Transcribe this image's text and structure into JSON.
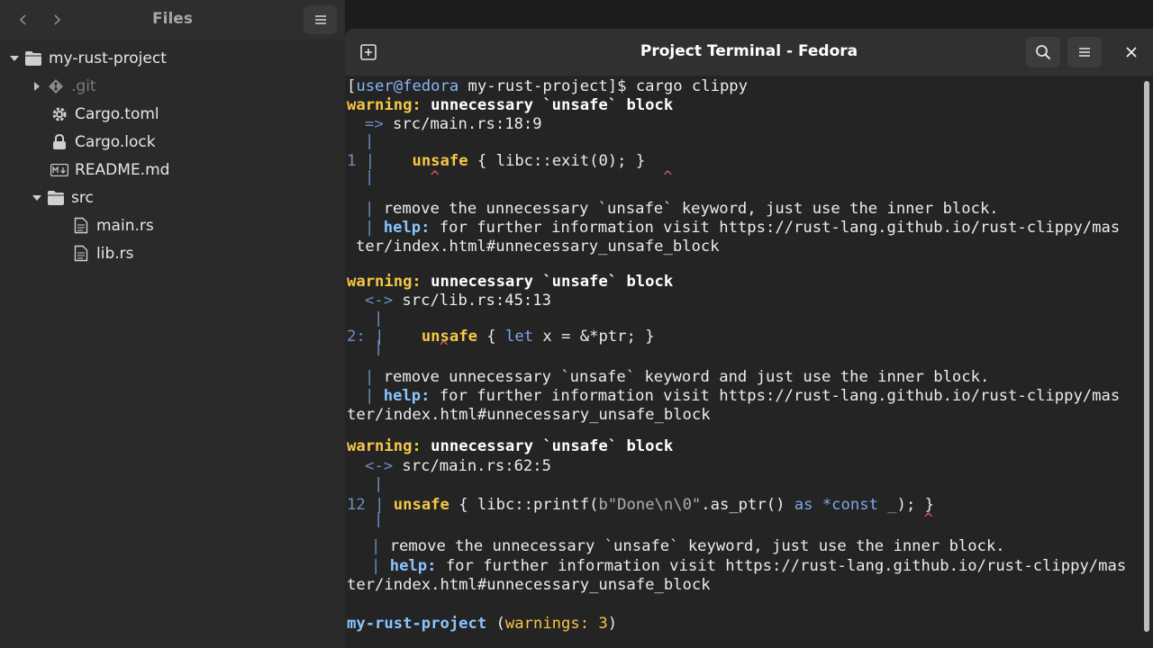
{
  "files": {
    "title": "Files",
    "back_icon": "chevron-left-icon",
    "forward_icon": "chevron-right-icon",
    "menu_icon": "hamburger-menu-icon",
    "tree": [
      {
        "label": "my-rust-project",
        "icon": "folder-icon",
        "expanded": true
      },
      {
        "label": ".git",
        "icon": "git-icon",
        "expanded": false
      },
      {
        "label": "Cargo.toml",
        "icon": "gear-icon"
      },
      {
        "label": "Cargo.lock",
        "icon": "lock-icon"
      },
      {
        "label": "README.md",
        "icon": "markdown-icon"
      },
      {
        "label": "src",
        "icon": "folder-icon",
        "expanded": true
      },
      {
        "label": "main.rs",
        "icon": "file-icon"
      },
      {
        "label": "lib.rs",
        "icon": "file-icon"
      }
    ]
  },
  "terminal": {
    "title": "Project Terminal - Fedora",
    "new_tab_icon": "new-tab-icon",
    "search_icon": "search-icon",
    "menu_icon": "hamburger-menu-icon",
    "close_icon": "close-icon",
    "prompt": {
      "open": "[",
      "user_host": "user@fedora",
      "dir": " my-rust-project",
      "close": "]$",
      "command": " cargo clippy"
    },
    "warnings": [
      {
        "head_label": "warning:",
        "head_text": " unnecessary `unsafe` block",
        "arrow": "=>",
        "location": " src/main.rs:18:9",
        "gutter": "|",
        "line_no": "1",
        "code_kw": "unsafe",
        "code_rest": " { libc::exit(0); }",
        "caret": "^",
        "caret2": "^",
        "note": " remove the unnecessary `unsafe` keyword, just use the inner block.",
        "help_label": "help:",
        "help_text": " for further information visit https://rust-lang.github.io/rust-clippy/mas",
        "help_wrap": "ter/index.html#unnecessary_unsafe_block"
      },
      {
        "head_label": "warning:",
        "head_text": " unnecessary `unsafe` block",
        "arrow": "<->",
        "location": " src/lib.rs:45:13",
        "gutter": "|",
        "line_no": "2:",
        "code_kw": "unsafe",
        "code_let": "let",
        "code_rest": " { ",
        "code_rest2": " x = &*ptr; }",
        "caret": "^",
        "note": " remove unnecessary `unsafe` keyword and just use the inner block.",
        "help_label": "help:",
        "help_text": " for further information visit https://rust-lang.github.io/rust-clippy/mas",
        "help_wrap": "ter/index.html#unnecessary_unsafe_block"
      },
      {
        "head_label": "warning:",
        "head_text": " unnecessary `unsafe` block",
        "arrow": "<->",
        "location": " src/main.rs:62:5",
        "gutter": "|",
        "line_no": "12",
        "code_kw": "unsafe",
        "code_a": " { libc::printf(",
        "code_b": "b\"Done\\n\\0\"",
        "code_c": ".as_ptr() ",
        "code_as": "as",
        "code_d": " ",
        "code_const": "*const _",
        "code_e": "); }",
        "caret": "^",
        "note": " remove the unnecessary `unsafe` keyword, just use the inner block.",
        "help_label": "help:",
        "help_text": " for further information visit https://rust-lang.github.io/rust-clippy/mas",
        "help_wrap": "ter/index.html#unnecessary_unsafe_block"
      }
    ],
    "summary": {
      "project": "my-rust-project",
      "open": " (",
      "label": "warnings: 3",
      "close": ")"
    }
  },
  "colors": {
    "accent_blue": "#8ab4f8",
    "warning_yellow": "#f6c744",
    "caret_red": "#e05a5a"
  }
}
